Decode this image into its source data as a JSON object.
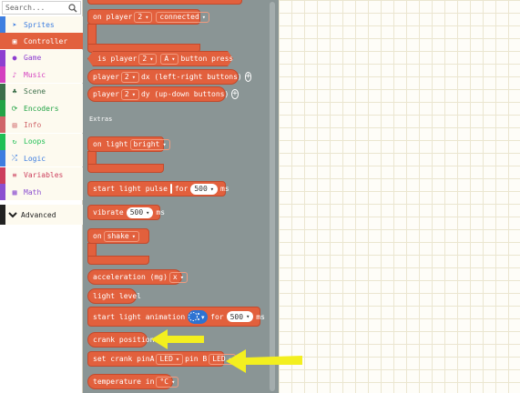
{
  "search": {
    "placeholder": "Search..."
  },
  "categories": [
    {
      "label": "Sprites",
      "color": "#3f7fe0",
      "icon": "sprites-icon"
    },
    {
      "label": "Controller",
      "color": "#e2603d",
      "icon": "controller-icon",
      "selected": true
    },
    {
      "label": "Game",
      "color": "#8e3fd0",
      "icon": "game-icon"
    },
    {
      "label": "Music",
      "color": "#d43fbf",
      "icon": "music-icon"
    },
    {
      "label": "Scene",
      "color": "#3c6f4a",
      "icon": "scene-icon"
    },
    {
      "label": "Encoders",
      "color": "#23a446",
      "icon": "encoders-icon"
    },
    {
      "label": "Info",
      "color": "#d06569",
      "icon": "info-icon"
    },
    {
      "label": "Loops",
      "color": "#20bf55",
      "icon": "loops-icon"
    },
    {
      "label": "Logic",
      "color": "#3d7de0",
      "icon": "logic-icon"
    },
    {
      "label": "Variables",
      "color": "#cc3e5c",
      "icon": "variables-icon"
    },
    {
      "label": "Math",
      "color": "#8b4fd0",
      "icon": "math-icon"
    }
  ],
  "advanced": {
    "label": "Advanced"
  },
  "extras_label": "Extras",
  "blocks": {
    "on_player": {
      "prefix": "on player",
      "player": "2",
      "event": "connected"
    },
    "is_player": {
      "prefix": "is player",
      "player": "2",
      "button": "A",
      "suffix": "button pressed"
    },
    "player_dx": {
      "prefix": "player",
      "player": "2",
      "suffix": "dx (left-right buttons)"
    },
    "player_dy": {
      "prefix": "player",
      "player": "2",
      "suffix": "dy (up-down buttons)"
    },
    "on_light": {
      "prefix": "on light",
      "value": "bright"
    },
    "light_pulse": {
      "prefix": "start light pulse",
      "for": "for",
      "duration": "500",
      "unit": "ms"
    },
    "vibrate": {
      "prefix": "vibrate",
      "duration": "500",
      "unit": "ms"
    },
    "on_shake": {
      "prefix": "on",
      "gesture": "shake"
    },
    "acceleration": {
      "prefix": "acceleration (mg)",
      "axis": "x"
    },
    "light_level": {
      "label": "light level"
    },
    "light_anim": {
      "prefix": "start light animation",
      "for": "for",
      "duration": "500",
      "unit": "ms"
    },
    "crank_position": {
      "label": "crank position"
    },
    "set_crank": {
      "prefix": "set crank pinA",
      "pinA": "LED",
      "mid": "pin B",
      "pinB": "LED"
    },
    "temperature": {
      "prefix": "temperature in",
      "unit": "°C"
    }
  },
  "colors": {
    "controller": "#e2603d",
    "flyout": "#8a9595",
    "arrow": "#f3ef1f"
  }
}
